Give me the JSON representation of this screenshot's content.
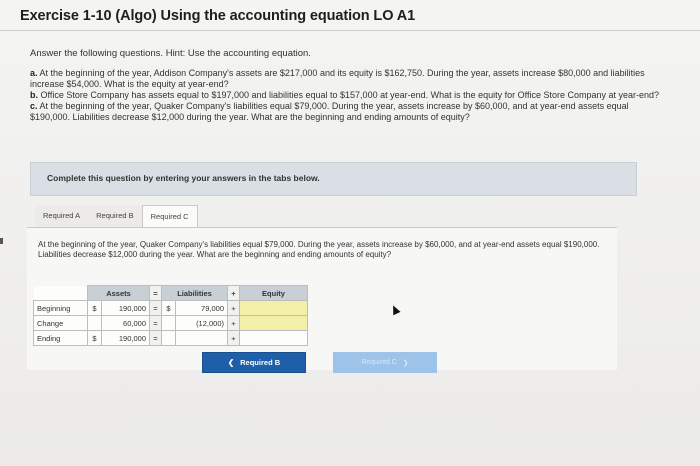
{
  "exercise": {
    "title": "Exercise 1-10 (Algo) Using the accounting equation LO A1",
    "intro": "Answer the following questions. Hint: Use the accounting equation.",
    "questions": [
      {
        "letter": "a.",
        "text": "At the beginning of the year, Addison Company's assets are $217,000 and its equity is $162,750. During the year, assets increase $80,000 and liabilities increase $54,000. What is the equity at year-end?"
      },
      {
        "letter": "b.",
        "text": "Office Store Company has assets equal to $197,000 and liabilities equal to $157,000 at year-end. What is the equity for Office Store Company at year-end?"
      },
      {
        "letter": "c.",
        "text": "At the beginning of the year, Quaker Company's liabilities equal $79,000. During the year, assets increase by $60,000, and at year-end assets equal $190,000. Liabilities decrease $12,000 during the year. What are the beginning and ending amounts of equity?"
      }
    ],
    "instruction": "Complete this question by entering your answers in the tabs below."
  },
  "tabs": [
    {
      "label": "Required A",
      "active": false
    },
    {
      "label": "Required B",
      "active": false
    },
    {
      "label": "Required C",
      "active": true
    }
  ],
  "panel": {
    "text": "At the beginning of the year, Quaker Company's liabilities equal $79,000. During the year, assets increase by $60,000, and at year-end assets equal $190,000. Liabilities decrease $12,000 during the year. What are the beginning and ending amounts of equity?"
  },
  "table": {
    "headers": {
      "assets": "Assets",
      "eq": "=",
      "liabilities": "Liabilities",
      "plus": "+",
      "equity": "Equity"
    },
    "rows": [
      {
        "label": "Beginning",
        "cur1": "$",
        "assets": "190,000",
        "eq": "=",
        "cur2": "$",
        "liabilities": "79,000",
        "plus": "+",
        "equity": ""
      },
      {
        "label": "Change",
        "cur1": "",
        "assets": "60,000",
        "eq": "=",
        "cur2": "",
        "liabilities": "(12,000)",
        "plus": "+",
        "equity": ""
      },
      {
        "label": "Ending",
        "cur1": "$",
        "assets": "190,000",
        "eq": "=",
        "cur2": "",
        "liabilities": "",
        "plus": "+",
        "equity": ""
      }
    ]
  },
  "nav": {
    "prev_label": "Required B",
    "next_label": "Required C"
  },
  "colors": {
    "input_highlight": "#f2f0a8",
    "header_bg": "#c8d0d6",
    "prev_button": "#1f5ea8",
    "next_button_disabled": "#9ec3e8"
  }
}
